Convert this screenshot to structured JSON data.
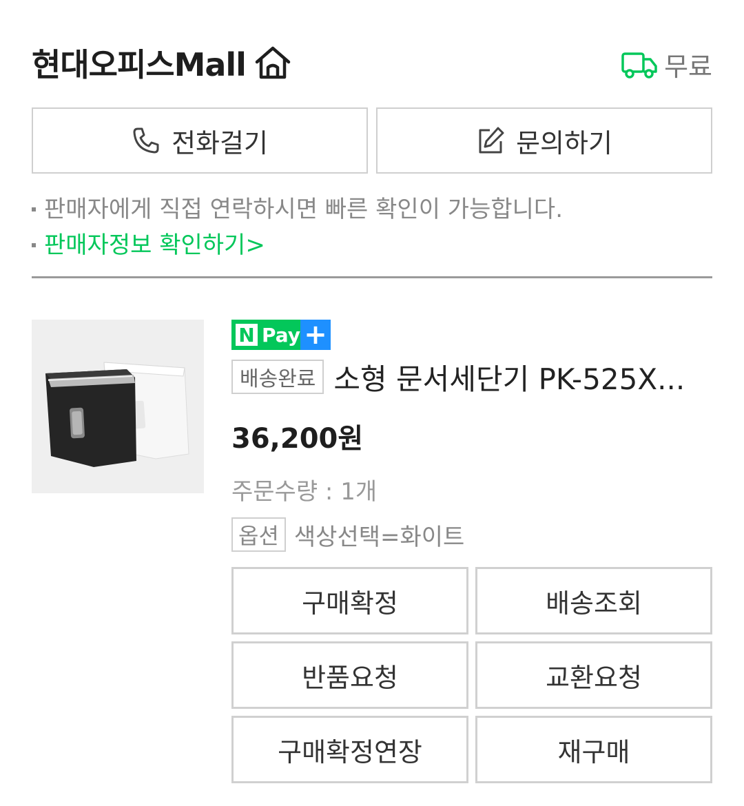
{
  "store": {
    "name": "현대오피스Mall",
    "home_icon": "home-icon",
    "shipping_label": "무료",
    "shipping_icon": "truck-icon",
    "shipping_icon_color": "#03c75a"
  },
  "contact": {
    "call_label": "전화걸기",
    "inquiry_label": "문의하기"
  },
  "notes": {
    "contact_note": "판매자에게 직접 연락하시면 빠른 확인이 가능합니다.",
    "seller_info_link": "판매자정보 확인하기>"
  },
  "order": {
    "badge_n": "N",
    "badge_pay": "Pay",
    "badge_plus": "+",
    "status": "배송완료",
    "product_name": "소형 문서세단기 PK-525X...",
    "price": "36,200원",
    "quantity": "주문수량 : 1개",
    "option_label": "옵션",
    "option_value": "색상선택=화이트"
  },
  "actions": [
    "구매확정",
    "배송조회",
    "반품요청",
    "교환요청",
    "구매확정연장",
    "재구매"
  ],
  "colors": {
    "accent_green": "#03c75a",
    "npay_plus_blue": "#1e90ff"
  }
}
